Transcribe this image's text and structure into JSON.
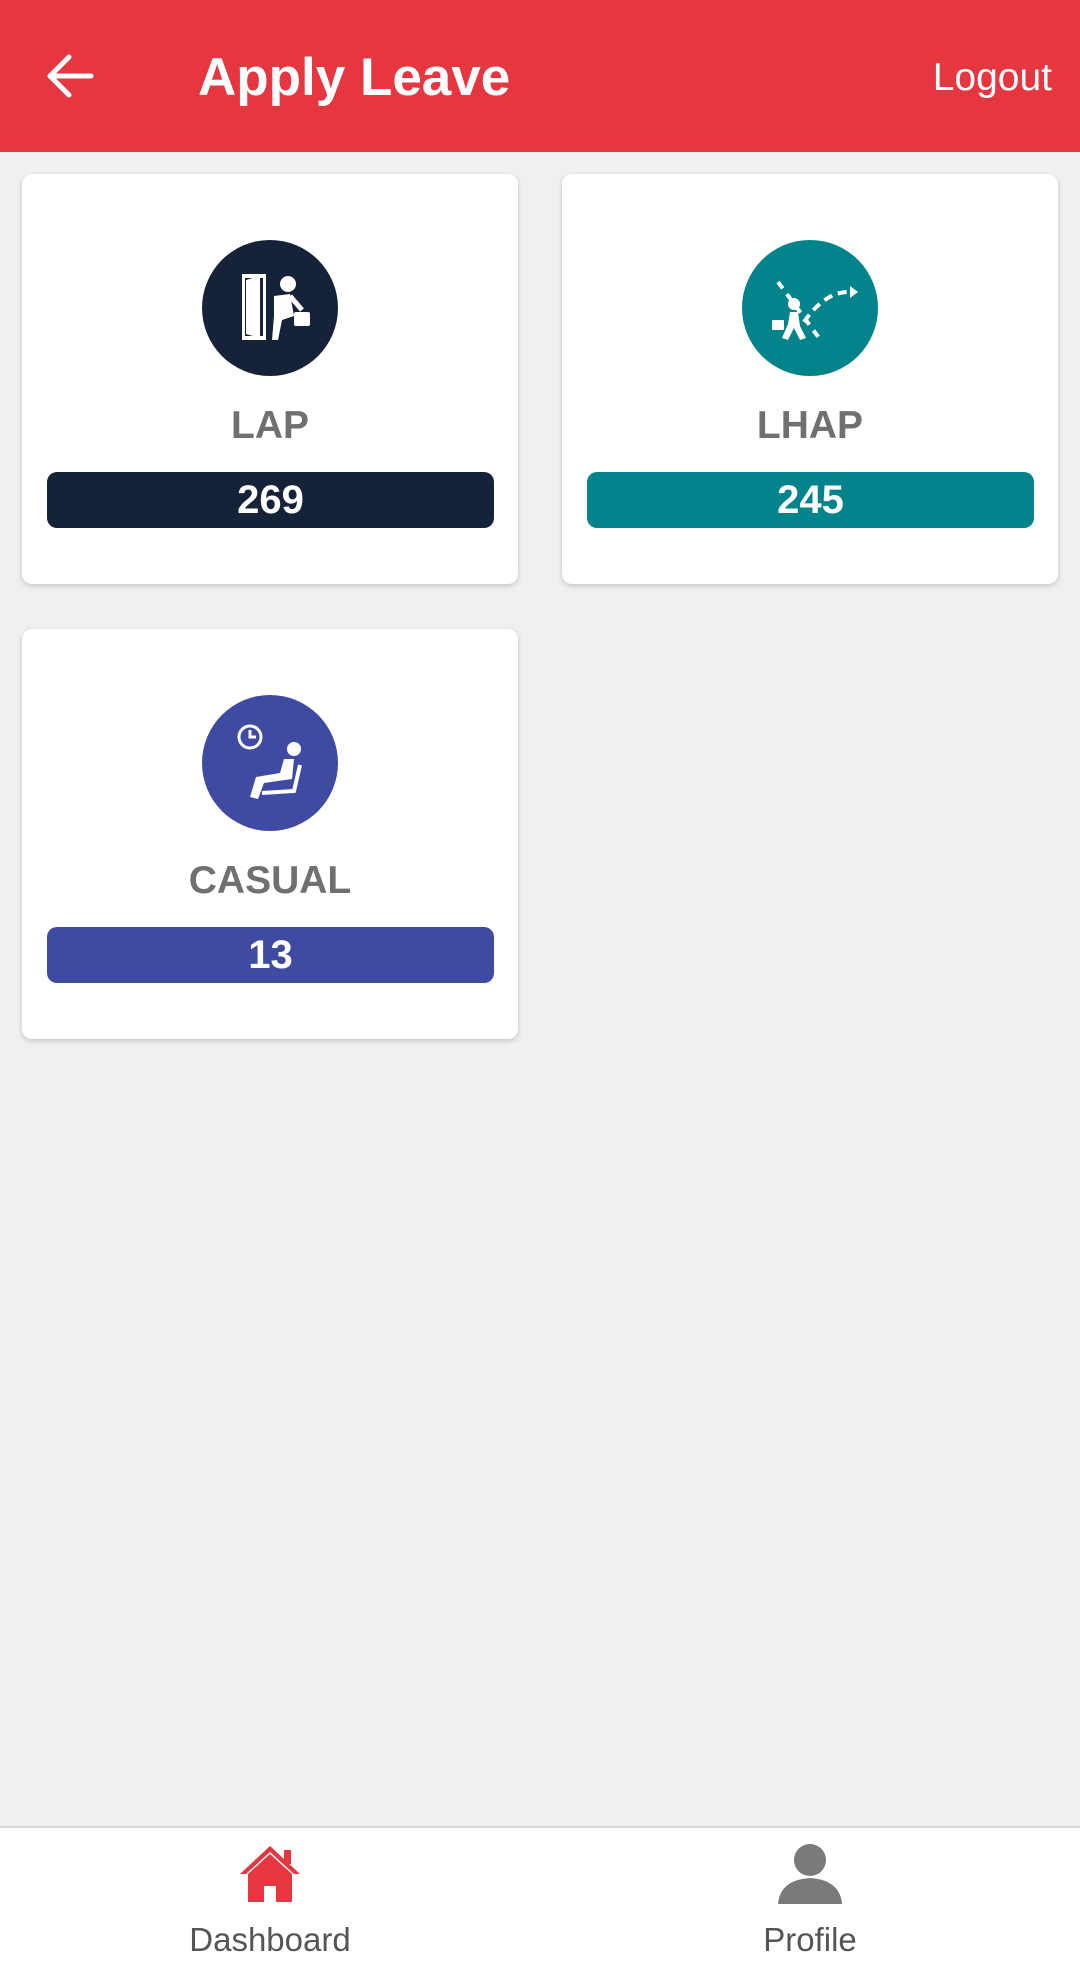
{
  "header": {
    "back_icon": "arrow-left-icon",
    "title": "Apply Leave",
    "logout_label": "Logout",
    "background_color": "#e63740"
  },
  "leave_cards": [
    {
      "label": "LAP",
      "count": "269",
      "icon": "person-leaving-door-icon",
      "color": "#152238"
    },
    {
      "label": "LHAP",
      "count": "245",
      "icon": "person-walking-path-icon",
      "color": "#00838a"
    },
    {
      "label": "CASUAL",
      "count": "13",
      "icon": "person-reclining-clock-icon",
      "color": "#3f4aa3"
    }
  ],
  "bottom_nav": {
    "items": [
      {
        "label": "Dashboard",
        "icon": "home-icon",
        "color": "#e63740"
      },
      {
        "label": "Profile",
        "icon": "person-icon",
        "color": "#7a7a7a"
      }
    ]
  }
}
